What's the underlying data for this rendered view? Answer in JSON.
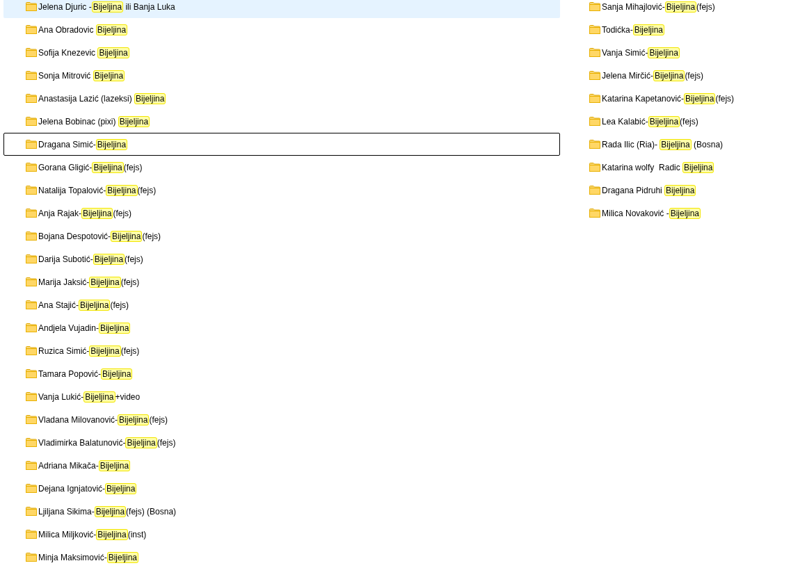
{
  "columns": [
    {
      "items": [
        {
          "before": "Jelena Djuric -",
          "match": "Bijeljina",
          "after": " ili Banja Luka",
          "hovered": true,
          "focused": false
        },
        {
          "before": "Ana Obradovic ",
          "match": "Bijeljina",
          "hovered": false,
          "focused": false
        },
        {
          "before": "Sofija Knezevic ",
          "match": "Bijeljina",
          "hovered": false,
          "focused": false
        },
        {
          "before": "Sonja Mitrović ",
          "match": "Bijeljina",
          "hovered": false,
          "focused": false
        },
        {
          "before": "Anastasija Lazić (lazeksi) ",
          "match": "Bijeljina",
          "hovered": false,
          "focused": false
        },
        {
          "before": "Jelena Bobinac (pixi) ",
          "match": "Bijeljina",
          "hovered": false,
          "focused": false
        },
        {
          "before": "Dragana Simić-",
          "match": "Bijeljina",
          "hovered": false,
          "focused": true
        },
        {
          "before": "Gorana Gligić-",
          "match": "Bijeljina",
          "after": "(fejs)",
          "hovered": false,
          "focused": false
        },
        {
          "before": "Natalija Topalović-",
          "match": "Bijeljina",
          "after": "(fejs)",
          "hovered": false,
          "focused": false
        },
        {
          "before": "Anja Rajak-",
          "match": "Bijeljina",
          "after": "(fejs)",
          "hovered": false,
          "focused": false
        },
        {
          "before": "Bojana Despotović-",
          "match": "Bijeljina",
          "after": "(fejs)",
          "hovered": false,
          "focused": false
        },
        {
          "before": "Darija Subotić-",
          "match": "Bijeljina",
          "after": "(fejs)",
          "hovered": false,
          "focused": false
        },
        {
          "before": "Marija Jaksić-",
          "match": "Bijeljina",
          "after": "(fejs)",
          "hovered": false,
          "focused": false
        },
        {
          "before": "Ana Stajić-",
          "match": "Bijeljina",
          "after": "(fejs)",
          "hovered": false,
          "focused": false
        },
        {
          "before": "Andjela Vujadin-",
          "match": "Bijeljina",
          "hovered": false,
          "focused": false
        },
        {
          "before": "Ruzica Simić-",
          "match": "Bijeljina",
          "after": "(fejs)",
          "hovered": false,
          "focused": false
        },
        {
          "before": "Tamara Popović-",
          "match": "Bijeljina",
          "hovered": false,
          "focused": false
        },
        {
          "before": "Vanja Lukić-",
          "match": "Bijeljina",
          "after": "+video",
          "hovered": false,
          "focused": false
        },
        {
          "before": "Vladana Milovanović-",
          "match": "Bijeljina",
          "after": "(fejs)",
          "hovered": false,
          "focused": false
        },
        {
          "before": "Vladimirka Balatunović-",
          "match": "Bijeljina",
          "after": "(fejs)",
          "hovered": false,
          "focused": false
        },
        {
          "before": "Adriana Mikača-",
          "match": "Bijeljina",
          "hovered": false,
          "focused": false
        },
        {
          "before": "Dejana Ignjatović-",
          "match": "Bijeljina",
          "hovered": false,
          "focused": false
        },
        {
          "before": "Ljiljana Sikima-",
          "match": "Bijeljina",
          "after": "(fejs) (Bosna)",
          "hovered": false,
          "focused": false
        },
        {
          "before": "Milica Miljković-",
          "match": "Bijeljina",
          "after": "(inst)",
          "hovered": false,
          "focused": false
        },
        {
          "before": "Minja Maksimović-",
          "match": "Bijeljina",
          "hovered": false,
          "focused": false
        }
      ]
    },
    {
      "items": [
        {
          "before": "Sanja Mihajlović-",
          "match": "Bijeljina",
          "after": "(fejs)",
          "hovered": false,
          "focused": false
        },
        {
          "before": "Todićka-",
          "match": "Bijeljina",
          "hovered": false,
          "focused": false
        },
        {
          "before": "Vanja Simić-",
          "match": "Bijeljina",
          "hovered": false,
          "focused": false
        },
        {
          "before": "Jelena Mirčić-",
          "match": "Bijeljina",
          "after": "(fejs)",
          "hovered": false,
          "focused": false
        },
        {
          "before": "Katarina Kapetanović-",
          "match": "Bijeljina",
          "after": "(fejs)",
          "hovered": false,
          "focused": false
        },
        {
          "before": "Lea Kalabić-",
          "match": "Bijeljina",
          "after": "(fejs)",
          "hovered": false,
          "focused": false
        },
        {
          "before": "Rada Ilic (Ria)- ",
          "match": "Bijeljina",
          "after": " (Bosna)",
          "hovered": false,
          "focused": false
        },
        {
          "before": "Katarina wolfy  Radic ",
          "match": "Bijeljina",
          "hovered": false,
          "focused": false
        },
        {
          "before": "Dragana Pidruhi ",
          "match": "Bijeljina",
          "hovered": false,
          "focused": false
        },
        {
          "before": "Milica Novaković -",
          "match": "Bijeljina",
          "hovered": false,
          "focused": false
        }
      ]
    }
  ]
}
